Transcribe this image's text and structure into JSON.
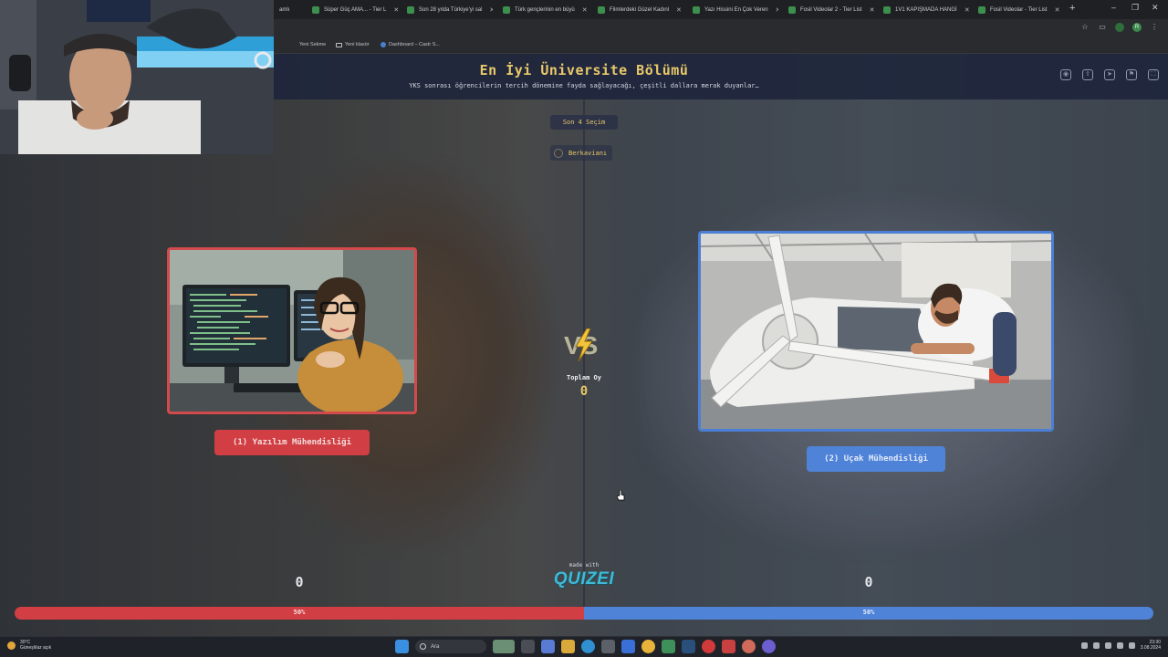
{
  "browser": {
    "tabs": [
      {
        "label": "amlı"
      },
      {
        "label": "Süper Güç AMA... - Tier L"
      },
      {
        "label": "Son 28 yılda Türkiye'yi sal"
      },
      {
        "label": "Türk gençlerinin en büyü"
      },
      {
        "label": "Filmlerdeki Güzel Kadınl"
      },
      {
        "label": "Yazı Hissini En Çok Veren"
      },
      {
        "label": "Fosil Videolar 2 - Tier List"
      },
      {
        "label": "1V1 KAPIŞMADA HANGİ"
      },
      {
        "label": "Fosil Videolar - Tier List"
      }
    ],
    "new_tab": "+",
    "window_controls": [
      "–",
      "❐",
      "✕"
    ],
    "profile_initial": "R",
    "bookmarks": [
      {
        "label": "Yeni Sekme",
        "icon": "page-icon"
      },
      {
        "label": "Yeni klasör",
        "icon": "folder-icon"
      },
      {
        "label": "Dashboard – Castr S...",
        "icon": "site-icon"
      }
    ]
  },
  "header": {
    "title": "En İyi Üniversite Bölümü",
    "subtitle": "YKS sonrası öğrencilerin tercih dönemine fayda sağlayacağı, çeşitli dallara merak duyanlar…",
    "icons": [
      "eye-icon",
      "share-icon",
      "send-icon",
      "flag-icon",
      "fullscreen-icon"
    ]
  },
  "match": {
    "round_badge": "Son 4 Seçim",
    "user": "Berkavianı",
    "total_votes_label": "Toplam Oy",
    "total_votes": "0",
    "left": {
      "label": "(1) Yazılım Mühendisliği",
      "votes": "0",
      "percent_text": "50%",
      "share": 0.5,
      "color": "#d13f44"
    },
    "right": {
      "label": "(2) Uçak Mühendisliği",
      "votes": "0",
      "percent_text": "50%",
      "share": 0.5,
      "color": "#4f83d8"
    },
    "made_with": "made with",
    "brand": "QUIZEI"
  },
  "taskbar": {
    "weather_temp": "30°C",
    "weather_desc": "Güneşli/az açık",
    "search_placeholder": "Ara",
    "time": "23:30",
    "date": "3.08.2024"
  }
}
